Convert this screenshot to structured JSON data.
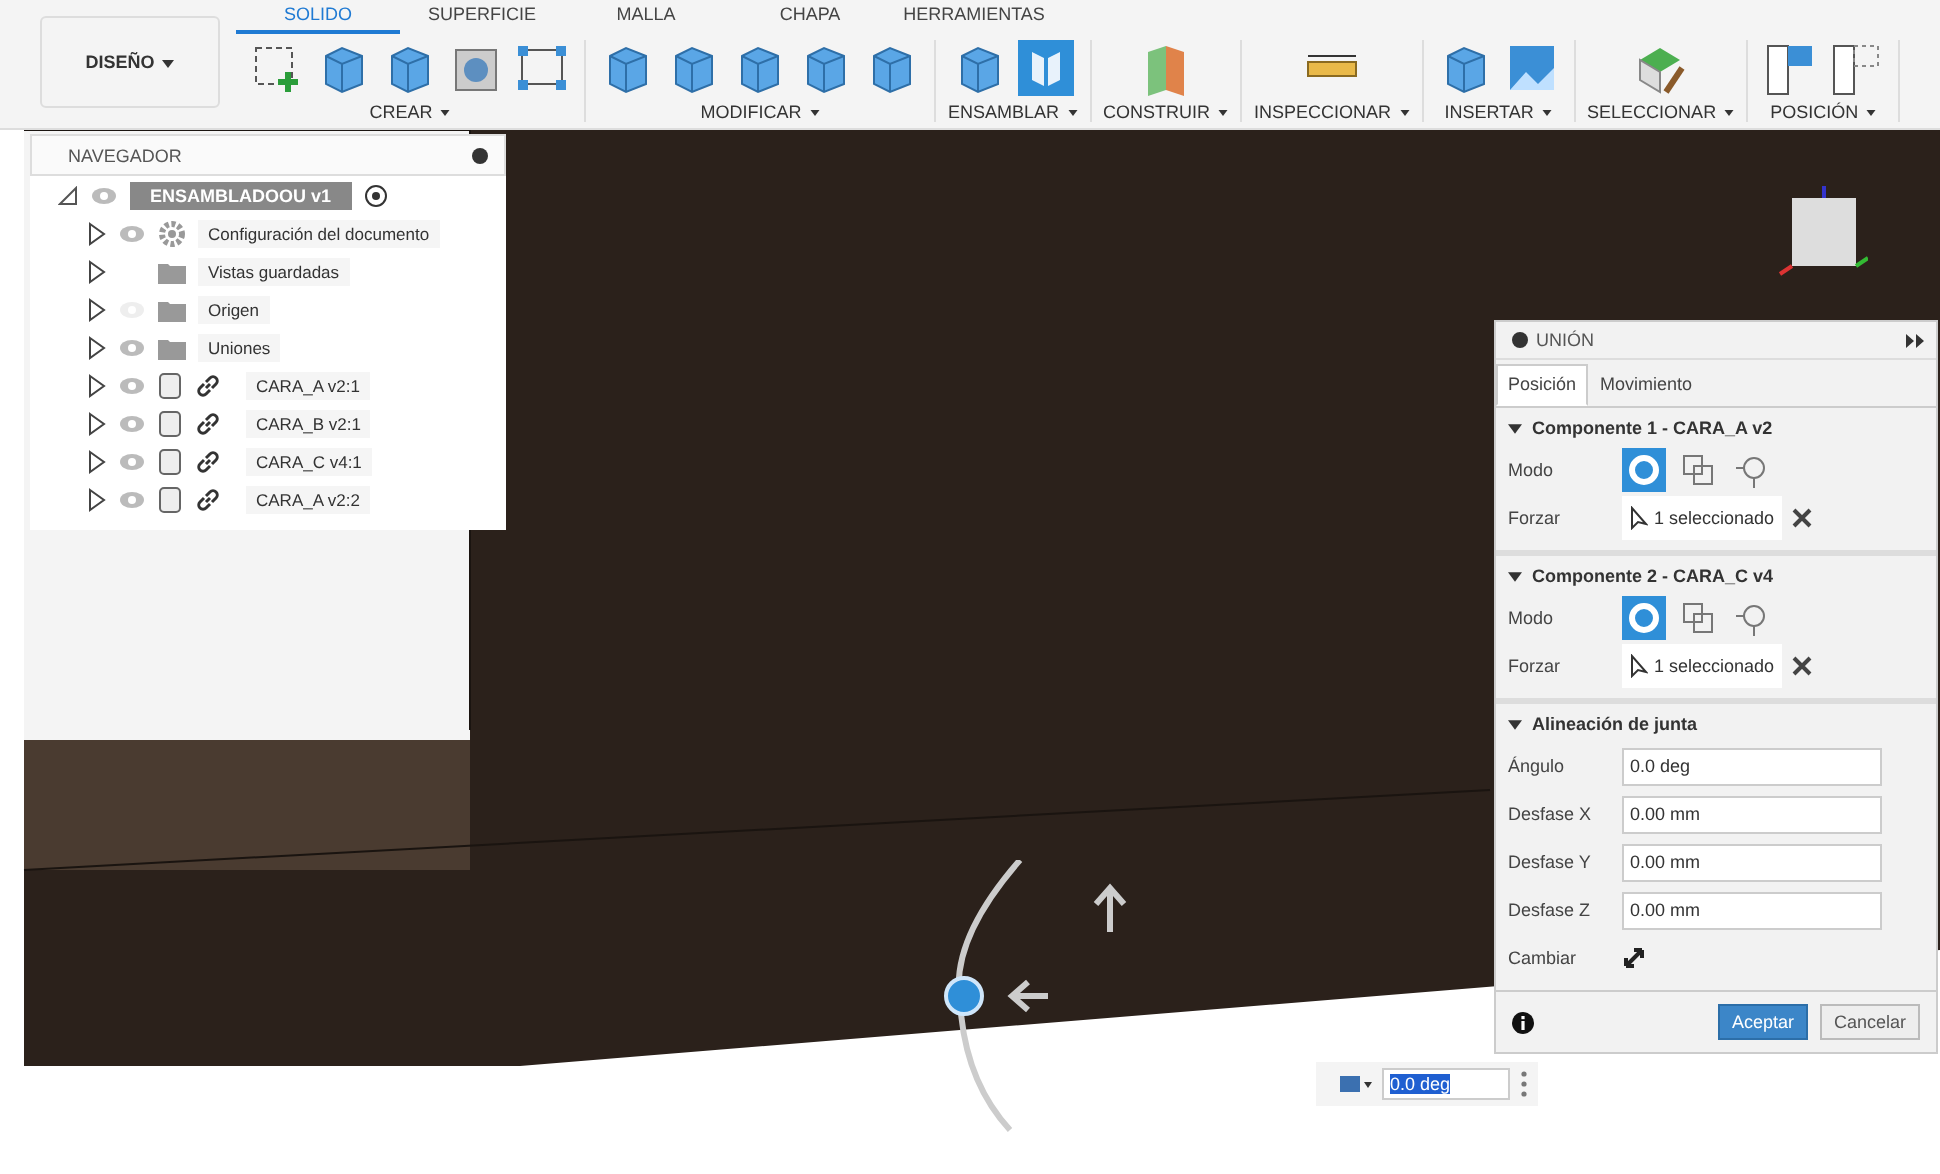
{
  "workspace_button": {
    "label": "DISEÑO"
  },
  "tabs": [
    {
      "label": "SOLIDO",
      "selected": true
    },
    {
      "label": "SUPERFICIE",
      "selected": false
    },
    {
      "label": "MALLA",
      "selected": false
    },
    {
      "label": "CHAPA",
      "selected": false
    },
    {
      "label": "HERRAMIENTAS",
      "selected": false
    }
  ],
  "tool_groups": [
    {
      "label": "CREAR",
      "tools": [
        {
          "kind": "sketch"
        },
        {
          "kind": "box"
        },
        {
          "kind": "pipe"
        },
        {
          "kind": "hole"
        },
        {
          "kind": "pattern"
        }
      ]
    },
    {
      "label": "MODIFICAR",
      "tools": [
        {
          "kind": "pushpull"
        },
        {
          "kind": "fillet"
        },
        {
          "kind": "shell"
        },
        {
          "kind": "combine"
        },
        {
          "kind": "split"
        }
      ]
    },
    {
      "label": "ENSAMBLAR",
      "tools": [
        {
          "kind": "newcomp"
        },
        {
          "kind": "joint"
        }
      ]
    },
    {
      "label": "CONSTRUIR",
      "tools": [
        {
          "kind": "plane"
        }
      ]
    },
    {
      "label": "INSPECCIONAR",
      "tools": [
        {
          "kind": "measure"
        }
      ]
    },
    {
      "label": "INSERTAR",
      "tools": [
        {
          "kind": "insert"
        },
        {
          "kind": "image"
        }
      ]
    },
    {
      "label": "SELECCIONAR",
      "tools": [
        {
          "kind": "select"
        }
      ]
    },
    {
      "label": "POSICIÓN",
      "tools": [
        {
          "kind": "pos1"
        },
        {
          "kind": "pos2"
        }
      ]
    }
  ],
  "navigator": {
    "title": "NAVEGADOR",
    "root": {
      "label": "ENSAMBLADOOU v1",
      "expanded": true,
      "visible": true,
      "children": [
        {
          "label": "Configuración del documento",
          "kind": "settings",
          "visible": true
        },
        {
          "label": "Vistas guardadas",
          "kind": "folder"
        },
        {
          "label": "Origen",
          "kind": "folder",
          "visible": false
        },
        {
          "label": "Uniones",
          "kind": "folder",
          "visible": true
        },
        {
          "label": "CARA_A v2:1",
          "kind": "component",
          "visible": true
        },
        {
          "label": "CARA_B v2:1",
          "kind": "component",
          "visible": true
        },
        {
          "label": "CARA_C v4:1",
          "kind": "component",
          "visible": true
        },
        {
          "label": "CARA_A v2:2",
          "kind": "component",
          "visible": true
        }
      ]
    }
  },
  "joint_dialog": {
    "title": "UNIÓN",
    "tabs": [
      {
        "label": "Posición",
        "selected": true
      },
      {
        "label": "Movimiento",
        "selected": false
      }
    ],
    "components": [
      {
        "heading": "Componente 1 - CARA_A v2",
        "mode_label": "Modo",
        "modes": [
          {
            "selected": true
          },
          {
            "selected": false
          },
          {
            "selected": false
          }
        ],
        "force_label": "Forzar",
        "force_value": "1 seleccionado"
      },
      {
        "heading": "Componente 2 - CARA_C v4",
        "mode_label": "Modo",
        "modes": [
          {
            "selected": true
          },
          {
            "selected": false
          },
          {
            "selected": false
          }
        ],
        "force_label": "Forzar",
        "force_value": "1 seleccionado"
      }
    ],
    "alignment": {
      "heading": "Alineación de junta",
      "fields": [
        {
          "label": "Ángulo",
          "value": "0.0 deg"
        },
        {
          "label": "Desfase X",
          "value": "0.00 mm"
        },
        {
          "label": "Desfase Y",
          "value": "0.00 mm"
        },
        {
          "label": "Desfase Z",
          "value": "0.00 mm"
        }
      ],
      "flip_label": "Cambiar"
    },
    "buttons": [
      {
        "label": "Aceptar",
        "primary": true
      },
      {
        "label": "Cancelar",
        "primary": false
      }
    ]
  },
  "angle_input": {
    "value": "0.0 deg"
  }
}
